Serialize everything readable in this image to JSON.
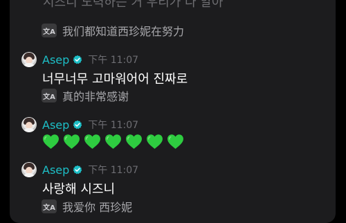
{
  "top_cut_text": "시즈니 노력하는 거 우리가 다 알아",
  "translate_icon_label": "文A",
  "translations": {
    "first": "我们都知道西珍妮在努力",
    "second": "真的非常感谢",
    "third": "我爱你 西珍妮"
  },
  "messages": [
    {
      "name": "Asep",
      "time": "下午 11:07",
      "text": "너무너무 고마워어어 진짜로"
    },
    {
      "name": "Asep",
      "time": "下午 11:07",
      "text": ""
    },
    {
      "name": "Asep",
      "time": "下午 11:07",
      "text": "사랑해 시즈니"
    }
  ],
  "heart_count": 7,
  "colors": {
    "accent": "#1dbfc7",
    "heart": "#2ecc40",
    "panel": "#1c1c1e",
    "background": "#000000"
  }
}
